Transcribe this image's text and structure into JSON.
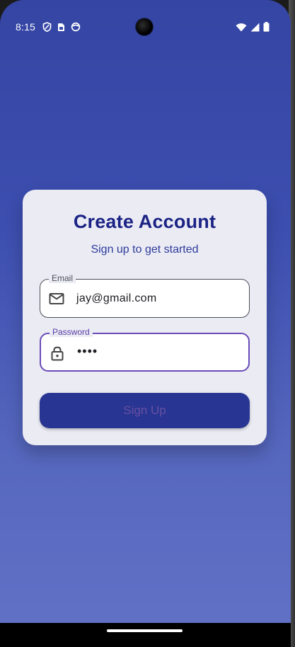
{
  "status_bar": {
    "time": "8:15",
    "left_icons": [
      "shield-icon",
      "sim-card-icon",
      "face-icon"
    ],
    "right_icons": [
      "wifi-icon",
      "signal-icon",
      "battery-icon"
    ]
  },
  "card": {
    "title": "Create Account",
    "subtitle": "Sign up to get started",
    "email": {
      "label": "Email",
      "value": "jay@gmail.com",
      "icon": "mail-icon"
    },
    "password": {
      "label": "Password",
      "value": "••••",
      "icon": "lock-icon"
    },
    "button_label": "Sign Up"
  },
  "colors": {
    "background_gradient_top": "#3545a4",
    "background_gradient_bottom": "#6272c6",
    "title": "#1b2384",
    "button": "#283592",
    "focus": "#6a4ab7"
  }
}
